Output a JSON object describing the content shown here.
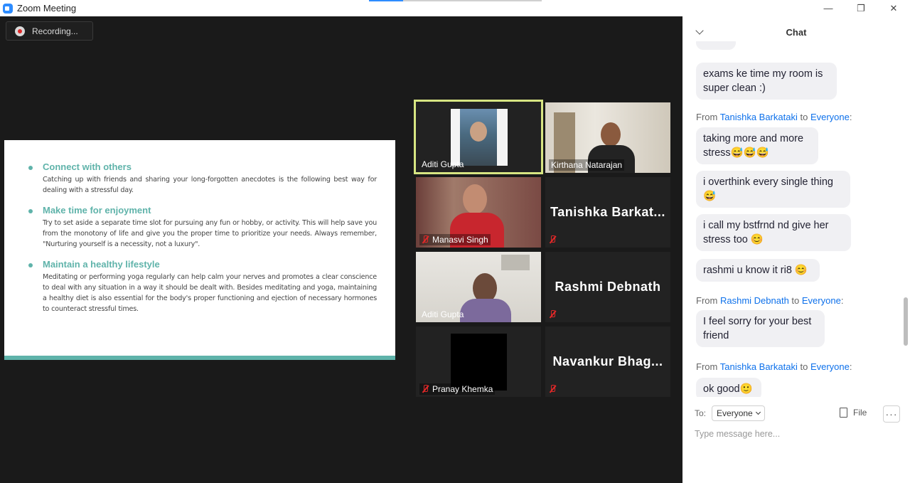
{
  "window": {
    "title": "Zoom Meeting",
    "minimize": "—",
    "restore": "❐",
    "close": "✕"
  },
  "recording": {
    "label": "Recording..."
  },
  "slide": {
    "bullets": [
      {
        "heading": "Connect with others",
        "body": "Catching up with friends and sharing your long-forgotten anecdotes is the following best way for dealing with a stressful day."
      },
      {
        "heading": "Make time for enjoyment",
        "body": "Try to set aside a separate time slot for pursuing any fun or hobby, or activity. This will help save you from the monotony of life and give you the proper time to prioritize your needs. Always remember, \"Nurturing yourself is a necessity, not a luxury\"."
      },
      {
        "heading": "Maintain a healthy lifestyle",
        "body": "Meditating or performing yoga regularly can help calm your nerves and promotes a clear conscience to deal with any situation in a way it should be dealt with. Besides meditating and yoga, maintaining a healthy diet is also essential for the body's proper functioning and ejection of necessary hormones to counteract stressful times."
      }
    ]
  },
  "participants": [
    {
      "name": "Aditi Gupta"
    },
    {
      "name": "Kirthana Natarajan"
    },
    {
      "name": "Manasvi Singh"
    },
    {
      "name": "Tanishka  Barkat..."
    },
    {
      "name": "Aditi Gupta"
    },
    {
      "name": "Rashmi Debnath"
    },
    {
      "name": "Pranay Khemka"
    },
    {
      "name": "Navankur  Bhag..."
    }
  ],
  "chat": {
    "title": "Chat",
    "messages": [
      {
        "text": "exams ke time my room is super clean :)"
      },
      {
        "from": "Tanishka Barkataki",
        "to": "Everyone",
        "from_prefix": "From",
        "to_word": "to"
      },
      {
        "text": "taking more and more stress😅😅😅"
      },
      {
        "text": "i overthink every single thing 😅"
      },
      {
        "text": "i call my bstfrnd nd give her stress too 😊"
      },
      {
        "text": "rashmi u know it ri8 😊"
      },
      {
        "from": "Rashmi Debnath",
        "to": "Everyone",
        "from_prefix": "From",
        "to_word": "to"
      },
      {
        "text": "I feel sorry for your best friend"
      },
      {
        "from": "Tanishka Barkataki",
        "to": "Everyone",
        "from_prefix": "From",
        "to_word": "to"
      },
      {
        "text": "ok good🙂"
      }
    ],
    "to_label": "To:",
    "to_value": "Everyone",
    "file_label": "File",
    "more_label": "···",
    "input_placeholder": "Type message here..."
  }
}
